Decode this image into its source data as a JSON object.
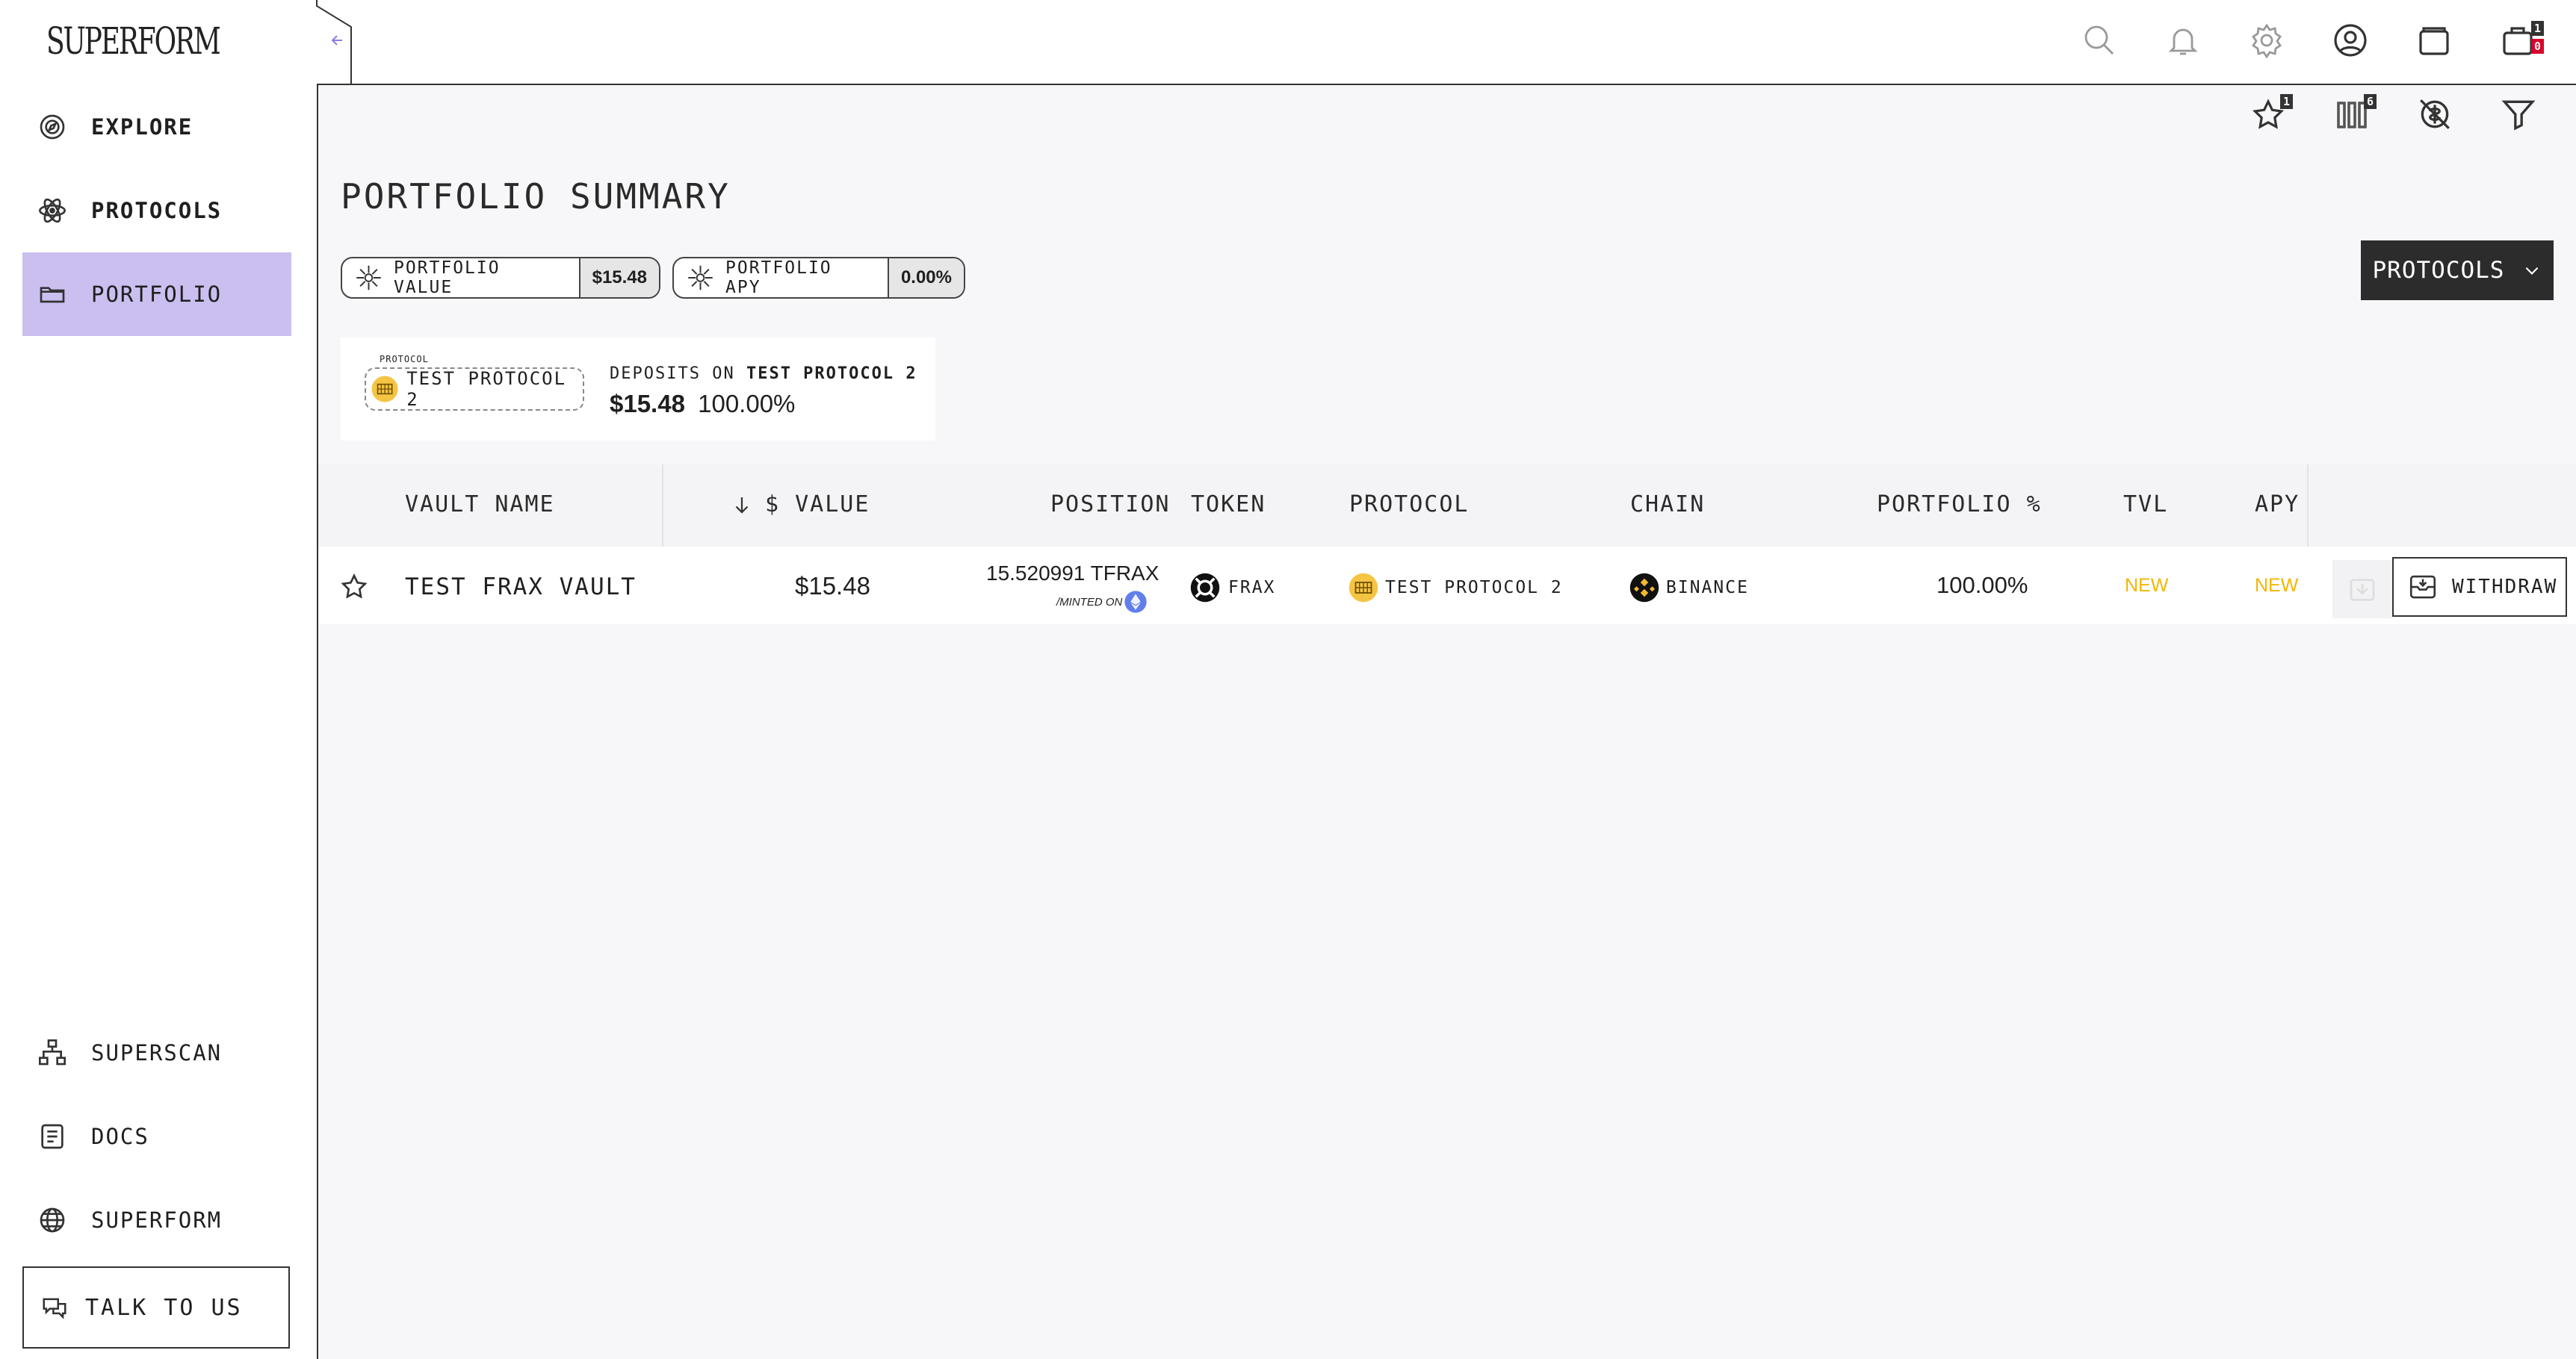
{
  "brand": {
    "logo": "SUPERFORM"
  },
  "sidebar": {
    "top_items": [
      {
        "label": "EXPLORE",
        "icon": "compass-icon"
      },
      {
        "label": "PROTOCOLS",
        "icon": "atom-icon"
      },
      {
        "label": "PORTFOLIO",
        "icon": "folder-icon",
        "active": true
      }
    ],
    "bottom_items": [
      {
        "label": "SUPERSCAN",
        "icon": "sitemap-icon"
      },
      {
        "label": "DOCS",
        "icon": "document-icon"
      },
      {
        "label": "SUPERFORM",
        "icon": "globe-icon"
      }
    ],
    "talk_label": "TALK TO US"
  },
  "header": {
    "icons": [
      "search-icon",
      "bell-icon",
      "gear-icon",
      "user-icon",
      "wallet-icon",
      "cart-icon"
    ],
    "cart_badge_top": "1",
    "cart_badge_bottom": "0"
  },
  "toolbar": {
    "favorites_badge": "1",
    "columns_badge": "6",
    "icons": [
      "star-icon",
      "columns-icon",
      "hide-small-icon",
      "filter-icon"
    ]
  },
  "page": {
    "title": "PORTFOLIO SUMMARY",
    "portfolio_value_label": "PORTFOLIO VALUE",
    "portfolio_value": "$15.48",
    "portfolio_apy_label": "PORTFOLIO APY",
    "portfolio_apy": "0.00%",
    "group_by_button": "PROTOCOLS"
  },
  "protocol_card": {
    "small_label": "PROTOCOL",
    "protocol_name": "TEST PROTOCOL 2",
    "deposits_prefix": "DEPOSITS ON",
    "deposits_protocol": "TEST PROTOCOL 2",
    "amount": "$15.48",
    "percent": "100.00%"
  },
  "table": {
    "columns": [
      "VAULT NAME",
      "$ VALUE",
      "POSITION",
      "TOKEN",
      "PROTOCOL",
      "CHAIN",
      "PORTFOLIO %",
      "TVL",
      "APY"
    ],
    "rows": [
      {
        "vault_name": "TEST FRAX VAULT",
        "value": "$15.48",
        "position": "15.520991 TFRAX",
        "minted_on": "/MINTED ON",
        "token": "FRAX",
        "protocol": "TEST PROTOCOL 2",
        "chain": "BINANCE",
        "portfolio_pct": "100.00%",
        "tvl": "NEW",
        "apy": "NEW",
        "action": "WITHDRAW"
      }
    ]
  },
  "colors": {
    "active_nav": "#cbbff0",
    "new_badge": "#f2b705",
    "dark_button": "#2c2c2c"
  }
}
